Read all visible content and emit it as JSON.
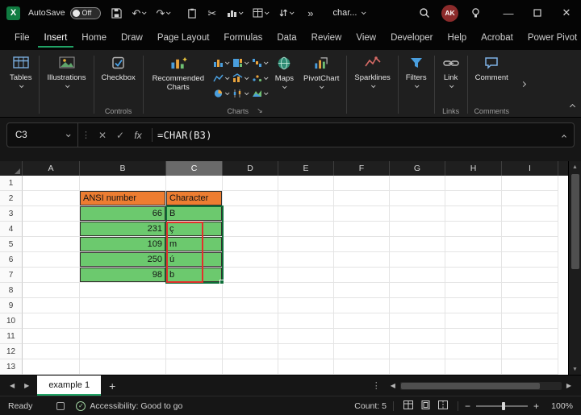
{
  "titlebar": {
    "app": "Excel",
    "autosave_label": "AutoSave",
    "autosave_state": "Off",
    "search_box": "char...",
    "avatar": "AK"
  },
  "menubar": {
    "tabs": [
      "File",
      "Insert",
      "Home",
      "Draw",
      "Page Layout",
      "Formulas",
      "Data",
      "Review",
      "View",
      "Developer",
      "Help",
      "Acrobat",
      "Power Pivot"
    ],
    "active_tab": "Insert"
  },
  "ribbon": {
    "tables": "Tables",
    "illustrations": "Illustrations",
    "checkbox": "Checkbox",
    "controls_group": "Controls",
    "recommended_charts": "Recommended Charts",
    "maps": "Maps",
    "pivotchart": "PivotChart",
    "charts_group": "Charts",
    "sparklines": "Sparklines",
    "filters": "Filters",
    "link": "Link",
    "links_group": "Links",
    "comment": "Comment",
    "comments_group": "Comments"
  },
  "formula_bar": {
    "name_box": "C3",
    "fx_label": "fx",
    "formula": "=CHAR(B3)"
  },
  "grid": {
    "column_headers": [
      "A",
      "B",
      "C",
      "D",
      "E",
      "F",
      "G",
      "H",
      "I"
    ],
    "visible_rows": 13,
    "selected_column": "C",
    "active_cell": "C3",
    "selection_range": "C3:C7",
    "annotation_range": "C4:C7",
    "cells": [
      {
        "col": "B",
        "row": 2,
        "text": "ANSI number",
        "type": "header"
      },
      {
        "col": "C",
        "row": 2,
        "text": "Character",
        "type": "header"
      },
      {
        "col": "B",
        "row": 3,
        "text": "66",
        "type": "number"
      },
      {
        "col": "C",
        "row": 3,
        "text": "B",
        "type": "char"
      },
      {
        "col": "B",
        "row": 4,
        "text": "231",
        "type": "number"
      },
      {
        "col": "C",
        "row": 4,
        "text": "ç",
        "type": "char"
      },
      {
        "col": "B",
        "row": 5,
        "text": "109",
        "type": "number"
      },
      {
        "col": "C",
        "row": 5,
        "text": "m",
        "type": "char"
      },
      {
        "col": "B",
        "row": 6,
        "text": "250",
        "type": "number"
      },
      {
        "col": "C",
        "row": 6,
        "text": "ú",
        "type": "char"
      },
      {
        "col": "B",
        "row": 7,
        "text": "98",
        "type": "number"
      },
      {
        "col": "C",
        "row": 7,
        "text": "b",
        "type": "char"
      }
    ]
  },
  "sheet_tabs": {
    "active_tab": "example 1",
    "add_label": "+"
  },
  "status_bar": {
    "mode": "Ready",
    "accessibility": "Accessibility: Good to go",
    "count": "Count: 5",
    "zoom": "100%"
  },
  "colors": {
    "table_header_fill": "#ED7D31",
    "table_data_fill": "#6CC96E",
    "annotation_red": "#E3302B",
    "accent_green": "#21A366",
    "avatar_bg": "#8C2B2B"
  }
}
